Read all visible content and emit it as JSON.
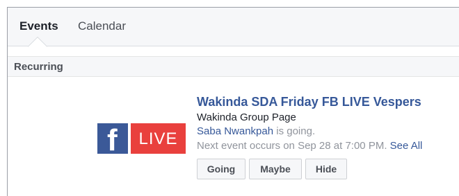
{
  "tabs": {
    "events_label": "Events",
    "calendar_label": "Calendar"
  },
  "section": {
    "title": "Recurring"
  },
  "event": {
    "image": {
      "fb_letter": "f",
      "live_label": "LIVE",
      "fb_color": "#3b5998",
      "live_color": "#e9403d"
    },
    "title": "Wakinda SDA Friday FB LIVE Vespers",
    "page_name": "Wakinda Group Page",
    "attendee_name": "Saba Nwankpah",
    "attendee_suffix": " is going.",
    "next_occurrence": "Next event occurs on Sep 28 at 7:00 PM.",
    "see_all_label": "See All",
    "buttons": {
      "going": "Going",
      "maybe": "Maybe",
      "hide": "Hide"
    }
  },
  "colors": {
    "link": "#365899",
    "muted_text": "#90949c",
    "header_bg": "#f6f7f9"
  }
}
